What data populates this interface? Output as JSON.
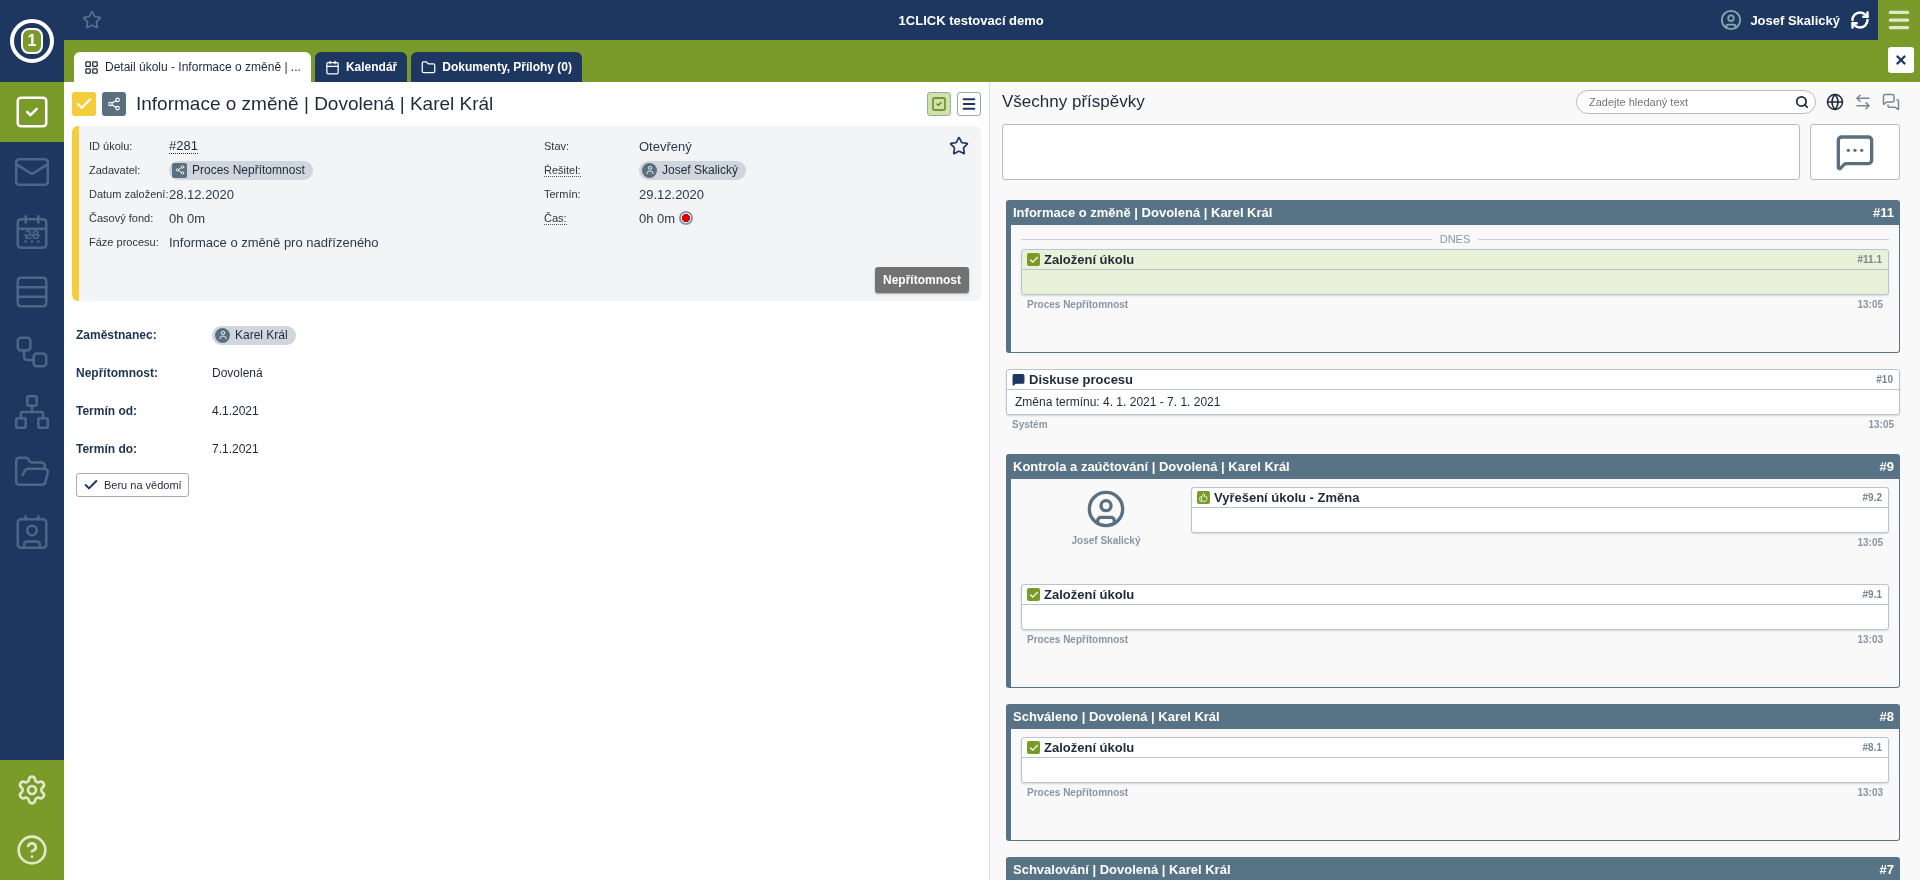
{
  "app": {
    "title": "1CLICK testovací demo",
    "user": "Josef Skalický",
    "logo": "1",
    "favorite": false
  },
  "nav": [
    {
      "kind": "tasks",
      "selected": true
    },
    {
      "kind": "mail",
      "selected": false
    },
    {
      "kind": "calendar",
      "label": "28",
      "selected": false
    },
    {
      "kind": "list",
      "selected": false
    },
    {
      "kind": "process",
      "selected": false
    },
    {
      "kind": "org",
      "selected": false
    },
    {
      "kind": "folder",
      "selected": false
    },
    {
      "kind": "contacts",
      "selected": false
    }
  ],
  "nav_bottom": [
    {
      "kind": "settings"
    },
    {
      "kind": "help"
    }
  ],
  "tabs": [
    {
      "kind": "detail",
      "label": "Detail úkolu - Informace o změně | ...",
      "selected": true
    },
    {
      "kind": "calendar",
      "label": "Kalendář",
      "selected": false
    },
    {
      "kind": "documents",
      "label": "Dokumenty, Přílohy (0)",
      "selected": false
    }
  ],
  "task": {
    "title": "Informace o změně | Dovolená | Karel Král",
    "done": true,
    "starred": false,
    "info_left": [
      {
        "label": "ID úkolu:",
        "value": "#281",
        "kind": "link"
      },
      {
        "label": "Zadavatel:",
        "value": "Proces Nepřítomnost",
        "kind": "process"
      },
      {
        "label": "Datum založení:",
        "value": "28.12.2020",
        "kind": "text"
      },
      {
        "label": "Časový fond:",
        "value": "0h 0m",
        "kind": "text"
      },
      {
        "label": "Fáze procesu:",
        "value": "Informace o změně pro nadřízeného",
        "kind": "text"
      }
    ],
    "info_right": [
      {
        "label": "Stav:",
        "value": "Otevřený",
        "kind": "text"
      },
      {
        "label": "Řešitel:",
        "value": "Josef Skalický",
        "kind": "user"
      },
      {
        "label": "Termín:",
        "value": "29.12.2020",
        "kind": "text"
      },
      {
        "label": "Čas:",
        "value": "0h 0m",
        "kind": "timer"
      }
    ],
    "tag_button": "Nepřítomnost",
    "fields": [
      {
        "label": "Zaměstnanec:",
        "value": "Karel Král",
        "kind": "person"
      },
      {
        "label": "Nepřítomnost:",
        "value": "Dovolená",
        "kind": "text"
      },
      {
        "label": "Termín od:",
        "value": "4.1.2021",
        "kind": "text"
      },
      {
        "label": "Termín do:",
        "value": "7.1.2021",
        "kind": "text"
      }
    ],
    "acknowledge_button": "Beru na vědomí"
  },
  "feed": {
    "title": "Všechny příspěvky",
    "search_placeholder": "Zadejte hledaný text",
    "items": [
      {
        "kind": "group",
        "title": "Informace o změně | Dovolená | Karel Král",
        "number": "#11",
        "divider": "DNES",
        "posts": [
          {
            "kind": "created",
            "title": "Založení úkolu",
            "number": "#11.1",
            "highlighted": true,
            "source": "Proces Nepřítomnost",
            "time": "13:05"
          }
        ]
      },
      {
        "kind": "discussion",
        "title": "Diskuse procesu",
        "number": "#10",
        "body": "Změna termínu: 4. 1. 2021 - 7. 1. 2021",
        "source": "Systém",
        "time": "13:05"
      },
      {
        "kind": "group",
        "title": "Kontrola a zaúčtování | Dovolená | Karel Král",
        "number": "#9",
        "posts": [
          {
            "kind": "resolved",
            "title": "Vyřešení úkolu - Změna",
            "number": "#9.2",
            "highlighted": false,
            "author": "Josef Skalický",
            "time": "13:05"
          },
          {
            "kind": "created",
            "title": "Založení úkolu",
            "number": "#9.1",
            "highlighted": false,
            "source": "Proces Nepřítomnost",
            "time": "13:03"
          }
        ]
      },
      {
        "kind": "group",
        "title": "Schváleno | Dovolená | Karel Král",
        "number": "#8",
        "posts": [
          {
            "kind": "created",
            "title": "Založení úkolu",
            "number": "#8.1",
            "highlighted": false,
            "source": "Proces Nepřítomnost",
            "time": "13:03"
          }
        ]
      },
      {
        "kind": "group",
        "title": "Schvalování | Dovolená | Karel Král",
        "number": "#7"
      }
    ]
  }
}
